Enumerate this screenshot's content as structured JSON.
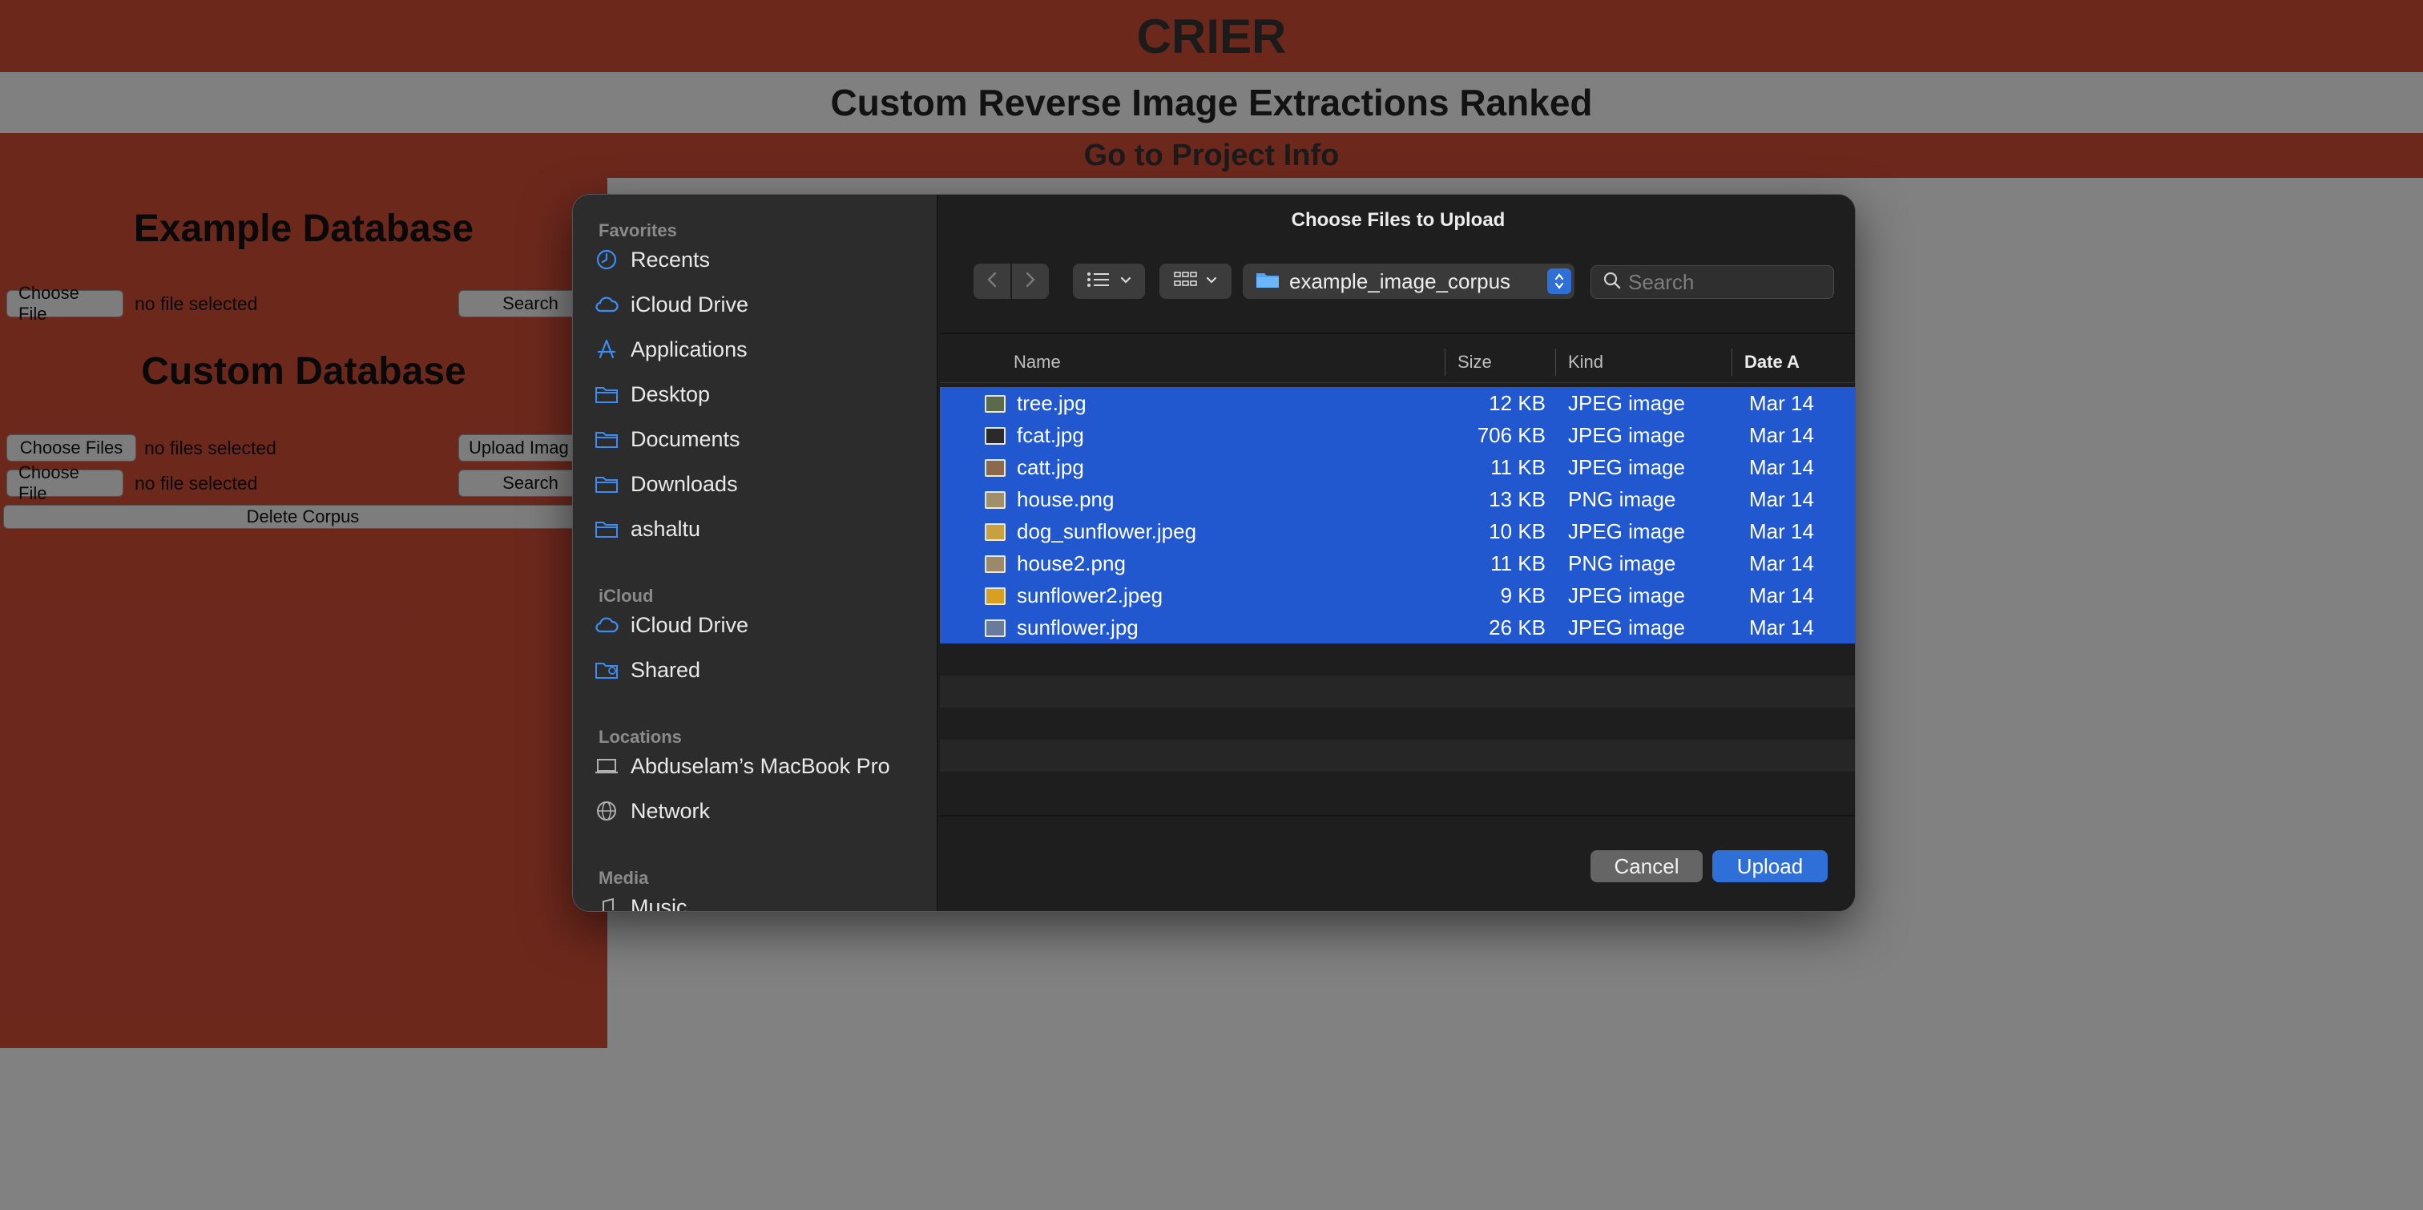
{
  "page": {
    "title": "CRIER",
    "subtitle": "Custom Reverse Image Extractions Ranked",
    "project_link": "Go to Project Info",
    "example_db": {
      "heading": "Example Database",
      "choose_file": "Choose File",
      "file_status": "no file selected",
      "search_label": "Search"
    },
    "custom_db": {
      "heading": "Custom Database",
      "choose_files": "Choose Files",
      "files_status": "no files selected",
      "upload_label": "Upload Imag",
      "choose_file": "Choose File",
      "file_status": "no file selected",
      "search_label": "Search",
      "delete_label": "Delete Corpus"
    }
  },
  "dialog": {
    "title": "Choose Files to Upload",
    "current_folder": "example_image_corpus",
    "search_placeholder": "Search",
    "sidebar": {
      "favorites_heading": "Favorites",
      "favorites": [
        {
          "label": "Recents",
          "icon": "clock-icon"
        },
        {
          "label": "iCloud Drive",
          "icon": "cloud-icon"
        },
        {
          "label": "Applications",
          "icon": "applications-icon"
        },
        {
          "label": "Desktop",
          "icon": "folder-icon"
        },
        {
          "label": "Documents",
          "icon": "folder-icon"
        },
        {
          "label": "Downloads",
          "icon": "folder-icon"
        },
        {
          "label": "ashaltu",
          "icon": "folder-icon"
        }
      ],
      "icloud_heading": "iCloud",
      "icloud": [
        {
          "label": "iCloud Drive",
          "icon": "cloud-icon"
        },
        {
          "label": "Shared",
          "icon": "shared-folder-icon"
        }
      ],
      "locations_heading": "Locations",
      "locations": [
        {
          "label": "Abduselam’s MacBook Pro",
          "icon": "laptop-icon"
        },
        {
          "label": "Network",
          "icon": "globe-icon"
        }
      ],
      "media_heading": "Media",
      "media_partial": "Music"
    },
    "columns": {
      "name": "Name",
      "size": "Size",
      "kind": "Kind",
      "date": "Date A"
    },
    "files": [
      {
        "name": "tree.jpg",
        "size": "12 KB",
        "kind": "JPEG image",
        "date": "Mar 14",
        "thumb": "#5b6b4a"
      },
      {
        "name": "fcat.jpg",
        "size": "706 KB",
        "kind": "JPEG image",
        "date": "Mar 14",
        "thumb": "#2a2a2a"
      },
      {
        "name": "catt.jpg",
        "size": "11 KB",
        "kind": "JPEG image",
        "date": "Mar 14",
        "thumb": "#8a6a4a"
      },
      {
        "name": "house.png",
        "size": "13 KB",
        "kind": "PNG image",
        "date": "Mar 14",
        "thumb": "#a0906a"
      },
      {
        "name": "dog_sunflower.jpeg",
        "size": "10 KB",
        "kind": "JPEG image",
        "date": "Mar 14",
        "thumb": "#c8a040"
      },
      {
        "name": "house2.png",
        "size": "11 KB",
        "kind": "PNG image",
        "date": "Mar 14",
        "thumb": "#9a8a6a"
      },
      {
        "name": "sunflower2.jpeg",
        "size": "9 KB",
        "kind": "JPEG image",
        "date": "Mar 14",
        "thumb": "#d8a020"
      },
      {
        "name": "sunflower.jpg",
        "size": "26 KB",
        "kind": "JPEG image",
        "date": "Mar 14",
        "thumb": "#6a7a9a"
      }
    ],
    "cancel_label": "Cancel",
    "upload_label": "Upload"
  },
  "colors": {
    "brand_red": "#ca4a35",
    "selection_blue": "#2258cf",
    "accent_blue": "#2f6fd8",
    "sidebar_icon_blue": "#3b8cf5"
  }
}
